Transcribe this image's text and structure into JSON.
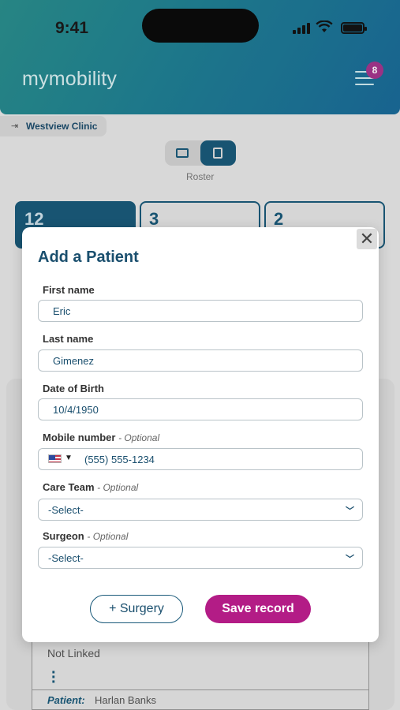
{
  "status_bar": {
    "time": "9:41"
  },
  "header": {
    "app_name": "mymobility",
    "menu_badge_count": "8"
  },
  "clinic": {
    "name": "Westview Clinic"
  },
  "view_toggle": {
    "label": "Roster",
    "selected": "list"
  },
  "stats": [
    {
      "value": "12"
    },
    {
      "value": "3"
    },
    {
      "value": "2"
    }
  ],
  "background_card": {
    "status": "Not Linked",
    "patient_label": "Patient:",
    "patient_name": "Harlan Banks"
  },
  "modal": {
    "title": "Add a Patient",
    "close_glyph": "✕",
    "first_name": {
      "label": "First name",
      "value": "Eric"
    },
    "last_name": {
      "label": "Last name",
      "value": "Gimenez"
    },
    "dob": {
      "label": "Date of Birth",
      "value": "10/4/1950"
    },
    "mobile": {
      "label": "Mobile number",
      "optional": "- Optional",
      "country": "US",
      "value": "(555) 555-1234"
    },
    "care_team": {
      "label": "Care Team",
      "optional": "- Optional",
      "value": "-Select-"
    },
    "surgeon": {
      "label": "Surgeon",
      "optional": "- Optional",
      "value": "-Select-"
    },
    "add_surgery_label": "+ Surgery",
    "save_label": "Save record"
  },
  "colors": {
    "primary": "#1a5a7a",
    "accent": "#b31c86",
    "header_gradient_start": "#2a8e8c",
    "header_gradient_end": "#1a6a98"
  }
}
